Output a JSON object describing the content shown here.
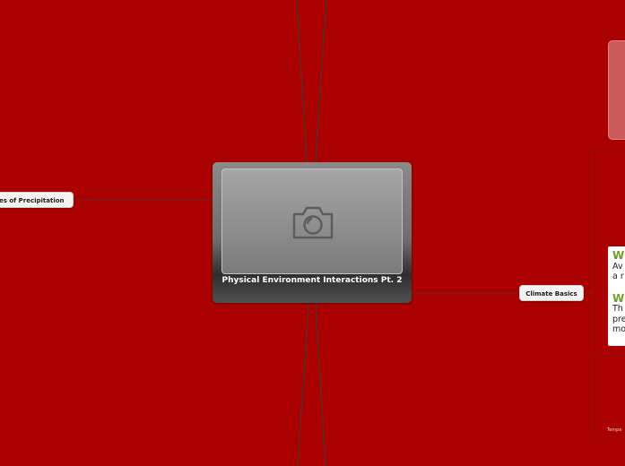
{
  "colors": {
    "background": "#ab0000",
    "connector": "#5d2a2a",
    "heading_green": "#6aa121"
  },
  "central_topic": {
    "title": "Physical Environment Interactions Pt. 2",
    "image_icon": "camera-icon"
  },
  "topics": {
    "left": "es of Precipitation",
    "right": "Climate Basics"
  },
  "right_notes": {
    "heading_1": "W",
    "text_1a": "Av",
    "text_1b": "a r",
    "heading_2": "W",
    "text_2a": "Th",
    "text_2b": "pre",
    "text_2c": "mo",
    "bottom_label": "Tempe"
  }
}
